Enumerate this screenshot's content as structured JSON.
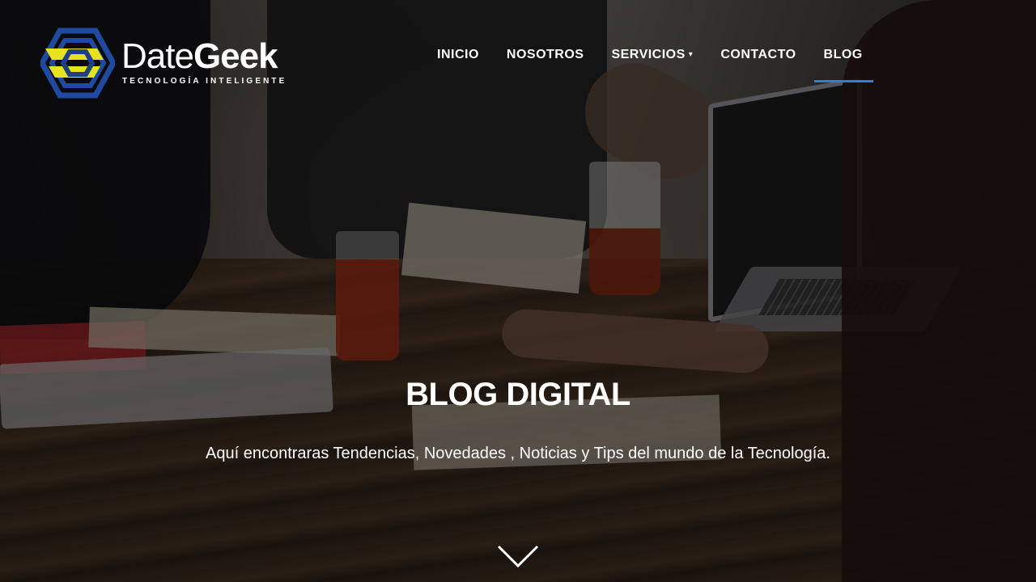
{
  "brand": {
    "name_light": "Date",
    "name_bold": "Geek",
    "tagline": "TECNOLOGÍA INTELIGENTE",
    "colors": {
      "accent_yellow": "#e7e21f",
      "accent_blue": "#1f4aa0",
      "underline_blue": "#2e7fd6"
    }
  },
  "nav": {
    "items": [
      {
        "label": "INICIO"
      },
      {
        "label": "NOSOTROS"
      },
      {
        "label": "SERVICIOS",
        "caret": "▾"
      },
      {
        "label": "CONTACTO"
      },
      {
        "label": "BLOG",
        "active": true
      }
    ]
  },
  "hero": {
    "title": "BLOG DIGITAL",
    "subtitle": "Aquí encontraras Tendencias, Novedades , Noticias y Tips del mundo de la Tecnología.",
    "scroll_icon": "chevron-down-icon"
  }
}
